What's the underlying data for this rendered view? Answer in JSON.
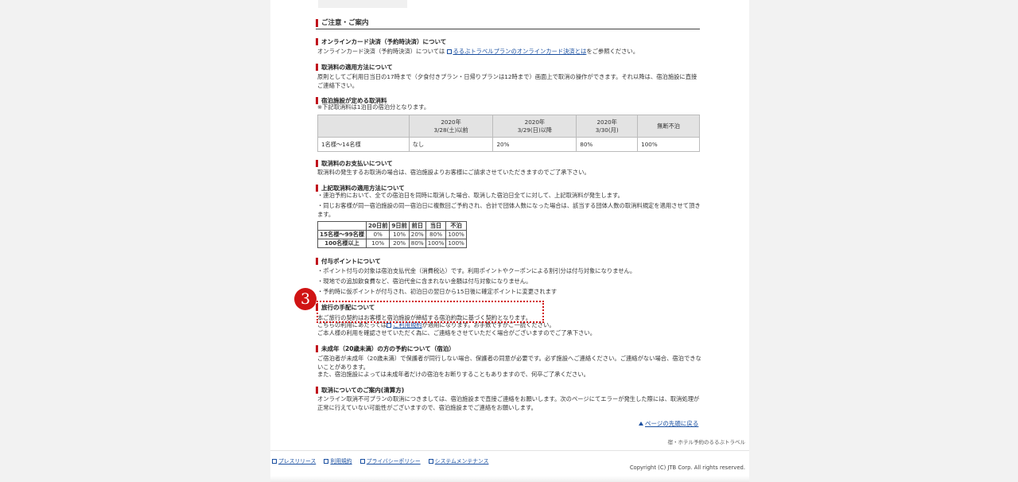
{
  "main_heading": "ご注意・ご案内",
  "sections": {
    "online_card": {
      "heading": "オンラインカード決済（予約時決済）について",
      "text_before": "オンラインカード決済（予約時決済）については",
      "link": "るるぶトラベルプランのオンラインカード決済とは",
      "text_after": "をご参照ください。"
    },
    "cancel_apply": {
      "heading": "取消料の適用方法について",
      "text": "原則としてご利用日当日の17時まで（夕食付きプラン・日帰りプランは12時まで）画面上で取消の操作ができます。それ以降は、宿泊施設に直接ご連絡下さい。"
    },
    "facility_fee": {
      "heading": "宿泊施設が定める取消料",
      "note": "※下記取消料は1泊目の宿泊分となります。",
      "table": {
        "headers": [
          "",
          "2020年\n3/28(土)以前",
          "2020年\n3/29(日)以降",
          "2020年\n3/30(月)",
          "無断不泊"
        ],
        "row": [
          "1名様〜14名様",
          "なし",
          "20%",
          "80%",
          "100%"
        ]
      }
    },
    "payment": {
      "heading": "取消料のお支払いについて",
      "text": "取消料の発生するお取消の場合は、宿泊施設よりお客様にご請求させていただきますのでご了承下さい。"
    },
    "above_apply": {
      "heading": "上記取消料の適用方法について",
      "line1": "・連泊予約において、全ての宿泊日を同時に取消した場合、取消した宿泊日全てに対して、上記取消料が発生します。",
      "line2": "・同じお客様が同一宿泊施設の同一宿泊日に複数回ご予約され、合計で団体人数になった場合は、該当する団体人数の取消料規定を適用させて頂きます。",
      "table": {
        "headers": [
          "",
          "20日前",
          "9日前",
          "前日",
          "当日",
          "不泊"
        ],
        "rows": [
          [
            "15名様〜99名様",
            "0%",
            "10%",
            "20%",
            "80%",
            "100%"
          ],
          [
            "100名様以上",
            "10%",
            "20%",
            "80%",
            "100%",
            "100%"
          ]
        ]
      }
    },
    "points": {
      "heading": "付与ポイントについて",
      "line1": "・ポイント付与の対象は宿泊支払代金（消費税込）です。利用ポイントやクーポンによる割引分は付与対象になりません。",
      "line2": "・現地での追加飲食費など、宿泊代金に含まれない金額は付与対象になりません。",
      "line3": "・予約時に仮ポイントが付与され、初泊日の翌日から15日後に確定ポイントに変更されます"
    },
    "travel": {
      "heading": "旅行の手配について",
      "line1": "本ご旅行の契約はお客様と宿泊施設が締結する宿泊約款に基づく契約となります。",
      "line2_before": "こちらの利用にあたっては",
      "line2_link": "ご利用規約",
      "line2_after": "が適用になります。お手数ですがご一読ください。",
      "line3": "ご本人様の利用を確認させていただく為に、ご連絡をさせていただく場合がございますのでご了承下さい。"
    },
    "minor": {
      "heading": "未成年（20歳未満）の方の予約について（宿泊）",
      "line1": "ご宿泊者が未成年（20歳未満）で保護者が同行しない場合、保護者の同意が必要です。必ず施設へご連絡ください。ご連絡がない場合、宿泊できないことがあります。",
      "line2": "また、宿泊施設によっては未成年者だけの宿泊をお断りすることもありますので、何卒ご了承ください。"
    },
    "cancel_info": {
      "heading": "取消についてのご案内(清算方)",
      "text": "オンライン取消不可プランの取消につきましては、宿泊施設まで直接ご連絡をお願いします。次のページにてエラーが発生した際には、取消処理が正常に行えていない可能性がございますので、宿泊施設までご連絡をお願いします。"
    }
  },
  "annotation_number": "3",
  "back_to_top": "ページの先頭に戻る",
  "brand": "宿・ホテル予約のるるぶトラベル",
  "footer": {
    "links": [
      "プレスリリース",
      "利用規約",
      "プライバシーポリシー",
      "システムメンテナンス"
    ],
    "copyright": "Copyright (C) JTB Corp. All rights reserved."
  },
  "colors": {
    "accent": "#c0141c",
    "link": "#1a4fa0",
    "annotation": "#d01414"
  }
}
